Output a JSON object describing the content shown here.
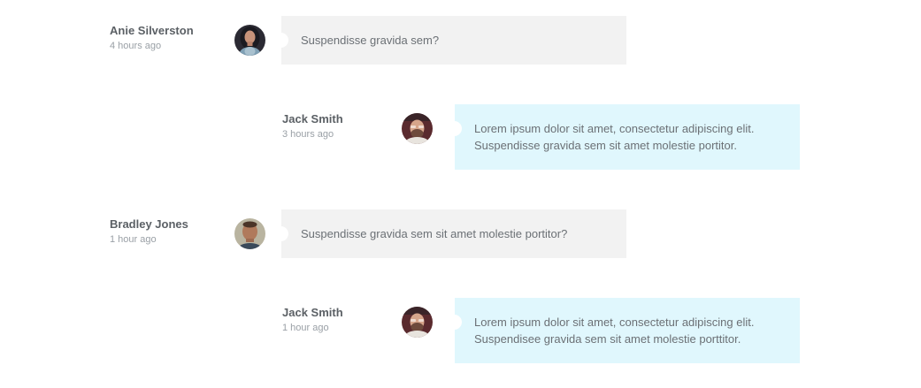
{
  "messages": [
    {
      "author": "Anie Silverston",
      "time": "4 hours ago",
      "avatar": "woman-avatar-icon",
      "style": "grey",
      "lines": [
        "Suspendisse gravida sem?"
      ]
    },
    {
      "author": "Jack Smith",
      "time": "3 hours ago",
      "avatar": "man-beard-avatar-icon",
      "style": "blue",
      "lines": [
        "Lorem ipsum dolor sit amet, consectetur adipiscing elit.",
        "Suspendisse gravida sem sit amet molestie portitor."
      ]
    },
    {
      "author": "Bradley Jones",
      "time": "1 hour ago",
      "avatar": "man-avatar-icon",
      "style": "grey",
      "lines": [
        "Suspendisse gravida sem sit amet molestie portitor?"
      ]
    },
    {
      "author": "Jack Smith",
      "time": "1 hour ago",
      "avatar": "man-beard-avatar-icon",
      "style": "blue",
      "lines": [
        "Lorem ipsum dolor sit amet, consectetur adipiscing elit.",
        "Suspendisee gravida sem sit amet molestie porttitor."
      ]
    }
  ],
  "colors": {
    "grey_bubble": "#f2f2f2",
    "blue_bubble": "#e0f7fd",
    "author_text": "#5b6065",
    "time_text": "#9aa0a6",
    "body_text": "#6b7075"
  }
}
